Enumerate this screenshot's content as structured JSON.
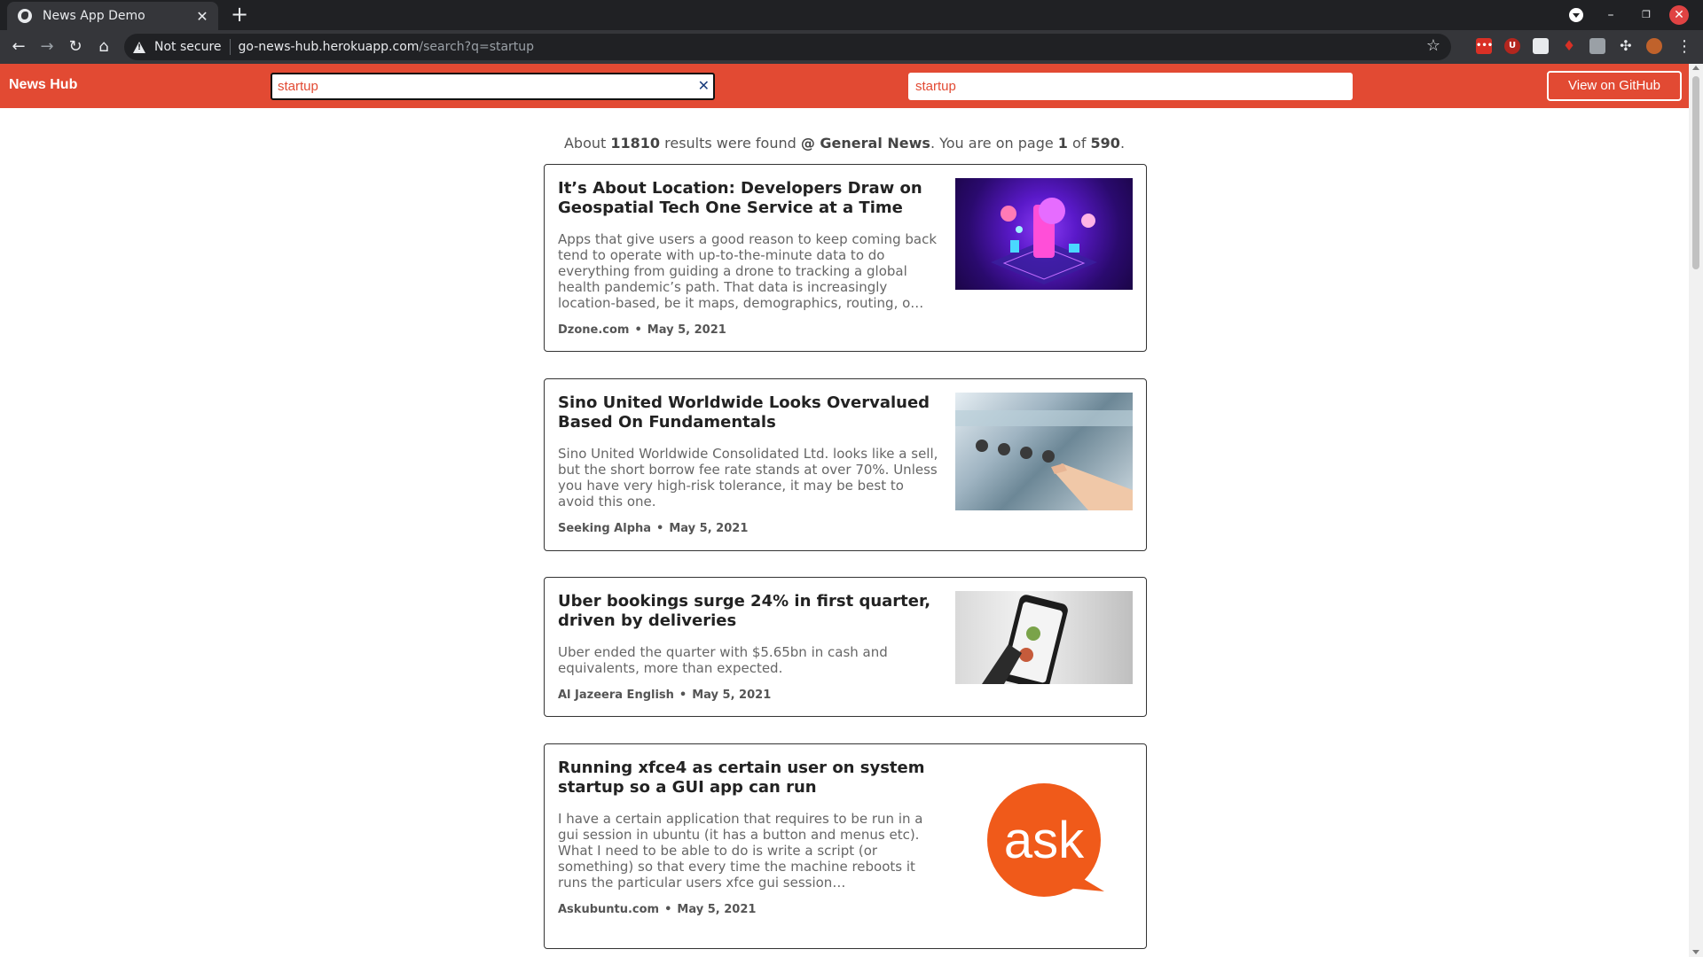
{
  "browser": {
    "tab_title": "News App Demo",
    "tab_close": "✕",
    "new_tab": "+",
    "security_label": "Not secure",
    "url_host": "go-news-hub.herokuapp.com",
    "url_path": "/search?q=startup",
    "icons": {
      "back": "arrow-left-icon",
      "forward": "arrow-right-icon",
      "reload": "reload-icon",
      "home": "home-icon",
      "bookmark": "star-icon",
      "menu": "kebab-menu-icon"
    }
  },
  "header": {
    "brand": "News Hub",
    "search_value": "startup",
    "search_clear": "✕",
    "search2_value": "startup",
    "github_button": "View on GitHub",
    "accent_color": "#e24a33"
  },
  "summary": {
    "prefix": "About ",
    "count": "11810",
    "mid": " results were found ",
    "category": "@ General News",
    "page_text": ". You are on page ",
    "page": "1",
    "of_text": " of ",
    "total_pages": "590",
    "suffix": "."
  },
  "articles": [
    {
      "title": "It’s About Location: Developers Draw on Geospatial Tech One Service at a Time",
      "description": "Apps that give users a good reason to keep coming back tend to operate with up-to-the-minute data to do everything from guiding a drone to tracking a global health pandemic’s path. That data is increasingly location-based, be it maps, demographics, routing, o…",
      "source": "Dzone.com",
      "separator": "•",
      "date": "May 5, 2021"
    },
    {
      "title": "Sino United Worldwide Looks Overvalued Based On Fundamentals",
      "description": "Sino United Worldwide Consolidated Ltd. looks like a sell, but the short borrow fee rate stands at over 70%. Unless you have very high-risk tolerance, it may be best to avoid this one.",
      "source": "Seeking Alpha",
      "separator": "•",
      "date": "May 5, 2021"
    },
    {
      "title": "Uber bookings surge 24% in first quarter, driven by deliveries",
      "description": "Uber ended the quarter with $5.65bn in cash and equivalents, more than expected.",
      "source": "Al Jazeera English",
      "separator": "•",
      "date": "May 5, 2021"
    },
    {
      "title": "Running xfce4 as certain user on system startup so a GUI app can run",
      "description": "I have a certain application that requires to be run in a gui session in ubuntu (it has a button and menus etc). What I need to be able to do is write a script (or something) so that every time the machine reboots it runs the particular users xfce gui session…",
      "source": "Askubuntu.com",
      "separator": "•",
      "date": "May 5, 2021",
      "logo_text": "ask"
    }
  ]
}
